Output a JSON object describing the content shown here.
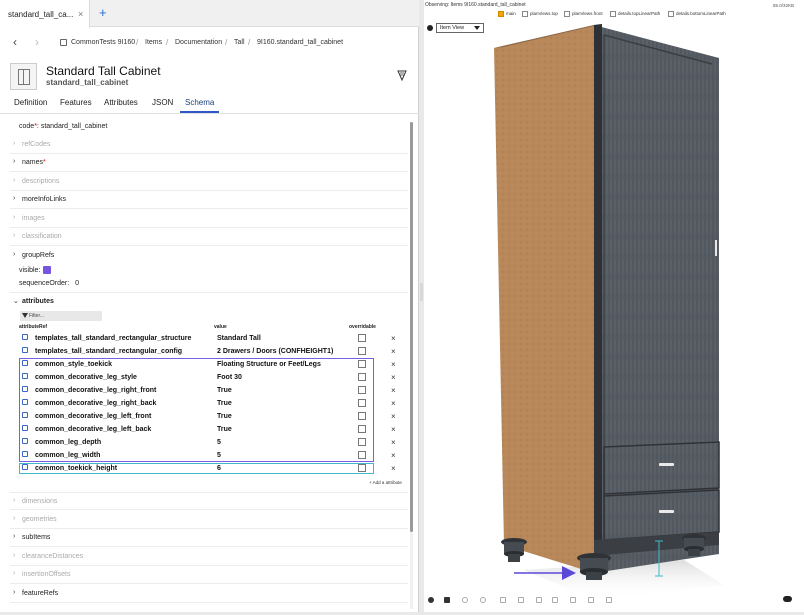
{
  "browser": {
    "tab_label": "standard_tall_ca...",
    "tab_close": "×",
    "new_tab": "+"
  },
  "breadcrumb": [
    "CommonTests 9I160",
    "Items",
    "Documentation",
    "Tall",
    "9I160.standard_tall_cabinet"
  ],
  "breadcrumb_sep": "/",
  "item": {
    "title": "Standard Tall Cabinet",
    "code": "standard_tall_cabinet"
  },
  "tabs": [
    "Definition",
    "Features",
    "Attributes",
    "JSON",
    "Schema"
  ],
  "active_tab": "Schema",
  "code_field": {
    "label": "code",
    "required_mark": "*",
    "sep": ":",
    "value": "standard_tall_cabinet"
  },
  "properties_top": [
    {
      "label": "refCodes",
      "dim": true,
      "chev": "›"
    },
    {
      "label": "names",
      "dim": false,
      "required": "*",
      "chev": "›"
    },
    {
      "label": "descriptions",
      "dim": true,
      "chev": "›"
    },
    {
      "label": "moreInfoLinks",
      "dim": false,
      "chev": "›"
    },
    {
      "label": "images",
      "dim": true,
      "chev": "›"
    },
    {
      "label": "classification",
      "dim": true,
      "chev": "›"
    },
    {
      "label": "groupRefs",
      "dim": false,
      "chev": "›"
    }
  ],
  "visible_label": "visible:",
  "sequence_order": {
    "label": "sequenceOrder:",
    "value": "0"
  },
  "attributes_section": {
    "label": "attributes",
    "chev": "⌄"
  },
  "filter_placeholder": "Filter...",
  "columns": {
    "ref": "attributeRef",
    "value": "value",
    "overridable": "overridable"
  },
  "attribute_rows": [
    {
      "ref": "templates_tall_standard_rectangular_structure",
      "value": "Standard Tall"
    },
    {
      "ref": "templates_tall_standard_rectangular_config",
      "value": "2 Drawers / Doors (CONFHEIGHT1)"
    },
    {
      "ref": "common_style_toekick",
      "value": "Floating Structure or Feet/Legs"
    },
    {
      "ref": "common_decorative_leg_style",
      "value": "Foot 30"
    },
    {
      "ref": "common_decorative_leg_right_front",
      "value": "True"
    },
    {
      "ref": "common_decorative_leg_right_back",
      "value": "True"
    },
    {
      "ref": "common_decorative_leg_left_front",
      "value": "True"
    },
    {
      "ref": "common_decorative_leg_left_back",
      "value": "True"
    },
    {
      "ref": "common_leg_depth",
      "value": "5"
    },
    {
      "ref": "common_leg_width",
      "value": "5"
    },
    {
      "ref": "common_toekick_height",
      "value": "6"
    }
  ],
  "delete_glyph": "×",
  "add_attribute": "+ Add a attribute",
  "properties_bottom": [
    {
      "label": "dimensions",
      "dim": true,
      "chev": "›"
    },
    {
      "label": "geometries",
      "dim": true,
      "chev": "›"
    },
    {
      "label": "subItems",
      "dim": false,
      "chev": "›"
    },
    {
      "label": "clearanceDistances",
      "dim": true,
      "chev": "›"
    },
    {
      "label": "insertionOffsets",
      "dim": true,
      "chev": "›"
    },
    {
      "label": "featureRefs",
      "dim": false,
      "chev": "›"
    }
  ],
  "viewer": {
    "observing": "Observing: Items 9I160.standard_tall_cabinet",
    "size": "85.0/32KB",
    "toggles": [
      {
        "label": "main",
        "on": true
      },
      {
        "label": "planViews.top",
        "on": false
      },
      {
        "label": "planViews.front",
        "on": false
      },
      {
        "label": "details.topLinearPath",
        "on": false
      },
      {
        "label": "details.bottomLinearPath",
        "on": false
      }
    ],
    "view_select": "Item View"
  },
  "colors": {
    "accent": "#2f57c5",
    "purple": "#7a5ee0",
    "teal": "#3fb8c8",
    "wood": "#b8875a",
    "cabinet_front": "#555b62"
  }
}
